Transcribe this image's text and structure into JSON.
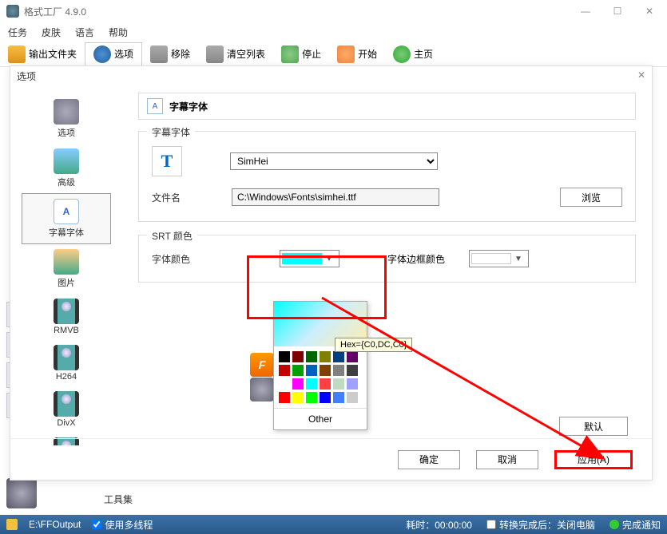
{
  "app": {
    "title": "格式工厂 4.9.0"
  },
  "menu": {
    "task": "任务",
    "skin": "皮肤",
    "lang": "语言",
    "help": "帮助"
  },
  "toolbar": {
    "output": "输出文件夹",
    "options": "选项",
    "remove": "移除",
    "clear": "清空列表",
    "stop": "停止",
    "start": "开始",
    "home": "主页"
  },
  "dialog": {
    "title": "选项",
    "header": "字幕字体",
    "fs_font": "字幕字体",
    "fs_srt": "SRT 颜色",
    "font_select": "SimHei",
    "filename_label": "文件名",
    "filename_value": "C:\\Windows\\Fonts\\simhei.ttf",
    "browse": "浏览",
    "font_color": "字体颜色",
    "border_color": "字体边框颜色",
    "default_btn": "默认",
    "color_other": "Other",
    "tooltip": "Hex={C0,DC,C0}",
    "ok": "确定",
    "cancel": "取消",
    "apply": "应用(A)"
  },
  "sidebar": {
    "items": [
      {
        "label": "选项"
      },
      {
        "label": "高级"
      },
      {
        "label": "字幕字体"
      },
      {
        "label": "图片"
      },
      {
        "label": "RMVB"
      },
      {
        "label": "H264"
      },
      {
        "label": "DivX"
      }
    ]
  },
  "bg": {
    "toolset": "工具集"
  },
  "status": {
    "output_path": "E:\\FFOutput",
    "multithread": "使用多线程",
    "elapsed": "耗时：00:00:00",
    "after_convert": "转换完成后：关闭电脑",
    "notify": "完成通知"
  },
  "colors": {
    "grid": [
      "#000000",
      "#7f0000",
      "#006600",
      "#7f7f00",
      "#004080",
      "#660066",
      "#c00000",
      "#00a000",
      "#0060c0",
      "#804000",
      "#808080",
      "#404040",
      "#ffffff",
      "#ff00ff",
      "#00ffff",
      "#ff4040",
      "#c0dcc0",
      "#a0a0ff",
      "#ff0000",
      "#ffff00",
      "#00ff00",
      "#0000ff",
      "#4080ff",
      "#cccccc"
    ]
  }
}
